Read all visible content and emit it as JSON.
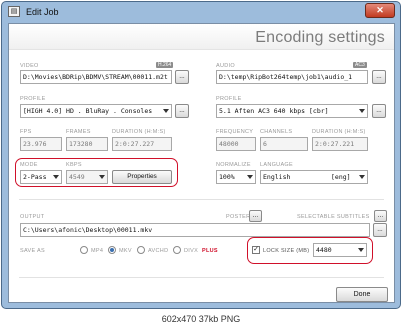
{
  "window": {
    "title": "Edit Job",
    "app_icon": "window-icon",
    "close_label": "✕"
  },
  "header": {
    "title": "Encoding settings"
  },
  "video": {
    "label": "VIDEO",
    "badge": "H.264",
    "path": "D:\\Movies\\BDRip\\BDMV\\STREAM\\00011.m2t",
    "browse_label": "...",
    "profile_label": "PROFILE",
    "profile_value": "[HIGH 4.0] HD . BluRay . Consoles",
    "fps_label": "FPS",
    "fps_value": "23.976",
    "frames_label": "FRAMES",
    "frames_value": "173280",
    "duration_label": "DURATION (H:M:S)",
    "duration_value": "2:0:27.227",
    "mode_label": "MODE",
    "mode_value": "2-Pass",
    "kbps_label": "KBPS",
    "kbps_value": "4549",
    "properties_label": "Properties"
  },
  "audio": {
    "label": "AUDIO",
    "badge": "AC3",
    "path": "D:\\temp\\RipBot264temp\\job1\\audio_1",
    "browse_label": "...",
    "profile_label": "PROFILE",
    "profile_value": "5.1 Aften  AC3    640 kbps [cbr]",
    "frequency_label": "FREQUENCY",
    "frequency_value": "48000",
    "channels_label": "CHANNELS",
    "channels_value": "6",
    "duration_label": "DURATION (H:M:S)",
    "duration_value": "2:0:27.221",
    "normalize_label": "NORMALIZE",
    "normalize_value": "100%",
    "language_label": "LANGUAGE",
    "language_name": "English",
    "language_code": "[eng]"
  },
  "output": {
    "label": "OUTPUT",
    "path": "C:\\Users\\afonic\\Desktop\\00011.mkv",
    "poster_label": "POSTER",
    "poster_button": "...",
    "subtitles_label": "SELECTABLE SUBTITLES",
    "subtitles_button": "...",
    "browse_label": "..."
  },
  "save_as": {
    "label": "SAVE AS",
    "options": [
      "MP4",
      "MKV",
      "AVCHD",
      "DIVX"
    ],
    "divx_suffix": "PLUS",
    "selected": "MKV",
    "lock_size_label": "LOCK SIZE (MB)",
    "lock_size_checked": true,
    "lock_size_value": "4480"
  },
  "done_label": "Done",
  "caption": "602x470  37kb  PNG",
  "colors": {
    "highlight": "#d0102a",
    "frame": "#9dbcdc",
    "close": "#c13a20"
  }
}
